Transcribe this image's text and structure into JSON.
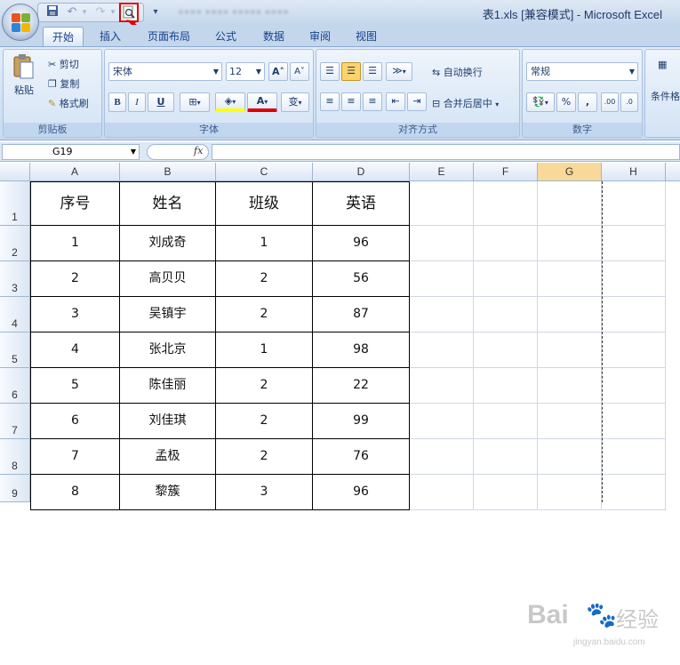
{
  "window": {
    "title": "表1.xls [兼容模式] - Microsoft Excel"
  },
  "tabs": [
    "开始",
    "插入",
    "页面布局",
    "公式",
    "数据",
    "审阅",
    "视图"
  ],
  "clipboard": {
    "paste": "粘贴",
    "cut": "剪切",
    "copy": "复制",
    "format_painter": "格式刷",
    "title": "剪贴板"
  },
  "font": {
    "name": "宋体",
    "size": "12",
    "bold": "B",
    "italic": "I",
    "underline": "U",
    "grow": "A",
    "shrink": "A",
    "wen": "变",
    "title": "字体"
  },
  "alignment": {
    "wrap": "自动换行",
    "merge": "合并后居中",
    "title": "对齐方式"
  },
  "number": {
    "format": "常规",
    "percent": "%",
    "comma": ",",
    "inc_decimal": ".00",
    "dec_decimal": ".0",
    "title": "数字"
  },
  "styles": {
    "label": "条件格"
  },
  "formula_bar": {
    "cell_ref": "G19",
    "fx": "fx",
    "value": ""
  },
  "columns": [
    "A",
    "B",
    "C",
    "D",
    "E",
    "F",
    "G",
    "H"
  ],
  "rows": [
    "1",
    "2",
    "3",
    "4",
    "5",
    "6",
    "7",
    "8",
    "9"
  ],
  "table": {
    "headers": [
      "序号",
      "姓名",
      "班级",
      "英语"
    ],
    "data": [
      [
        "1",
        "刘成奇",
        "1",
        "96"
      ],
      [
        "2",
        "高贝贝",
        "2",
        "56"
      ],
      [
        "3",
        "吴镇宇",
        "2",
        "87"
      ],
      [
        "4",
        "张北京",
        "1",
        "98"
      ],
      [
        "5",
        "陈佳丽",
        "2",
        "22"
      ],
      [
        "6",
        "刘佳琪",
        "2",
        "99"
      ],
      [
        "7",
        "孟极",
        "2",
        "76"
      ],
      [
        "8",
        "黎簇",
        "3",
        "96"
      ]
    ]
  },
  "watermark": {
    "brand": "Bai",
    "brand2": "经验",
    "url": "jingyan.baidu.com"
  },
  "colors": {
    "accent": "#e00000",
    "selected_col": "#f9d99a"
  }
}
